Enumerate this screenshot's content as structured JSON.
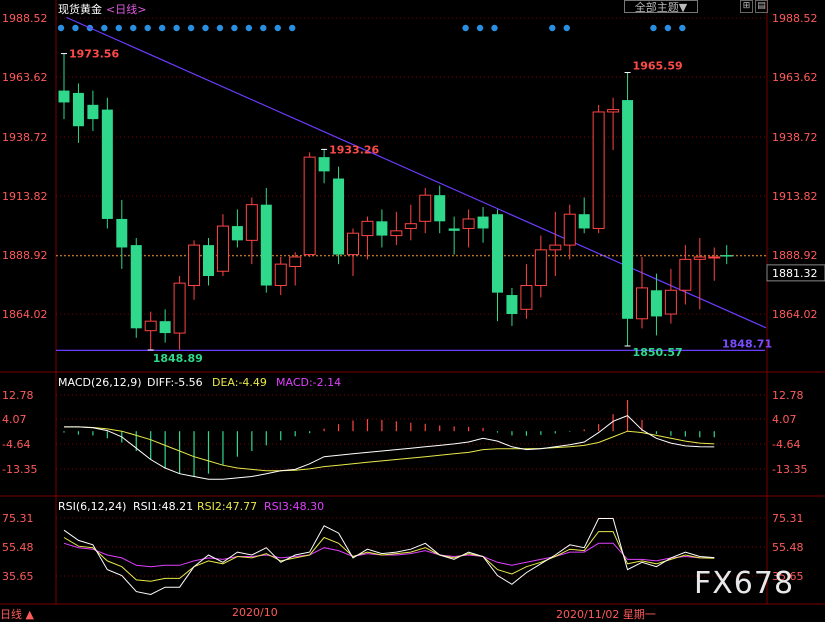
{
  "header": {
    "title": "现货黄金",
    "period": "<日线>",
    "theme_button": "全部主题▼",
    "tool_icon_1": "⊞",
    "tool_icon_2": "▤"
  },
  "colors": {
    "up": "#ff4444",
    "down": "#2fd88a",
    "grid": "#7a0000",
    "axis_label": "#ff5a5a",
    "trendline": "#6a3cff",
    "last_price_line": "#d79a3a",
    "macd_diff": "#ffffff",
    "macd_dea": "#e8e84a",
    "rsi1": "#ffffff",
    "rsi2": "#e8e84a",
    "rsi3": "#e040ff",
    "dots": "#2a8fe0"
  },
  "price_axis": {
    "ticks": [
      "1988.52",
      "1963.62",
      "1938.72",
      "1913.82",
      "1888.92",
      "1864.02"
    ],
    "last_price": "1881.32"
  },
  "annotations": {
    "high1": "1973.56",
    "low1": "1848.89",
    "mid_high": "1933.26",
    "high2": "1965.59",
    "low2": "1850.57",
    "support": "1848.71"
  },
  "macd": {
    "legend_name": "MACD(26,12,9)",
    "diff": "DIFF:-5.56",
    "dea": "DEA:-4.49",
    "macd": "MACD:-2.14",
    "ticks": [
      "12.78",
      "4.07",
      "-4.64",
      "-13.35"
    ]
  },
  "rsi": {
    "legend_name": "RSI(6,12,24)",
    "rsi1": "RSI1:48.21",
    "rsi2": "RSI2:47.77",
    "rsi3": "RSI3:48.30",
    "ticks": [
      "75.31",
      "55.48",
      "35.65"
    ]
  },
  "bottom": {
    "period_label": "日线 ▲",
    "date1": "2020/10",
    "date2": "2020/11/02 星期一"
  },
  "watermark": "FX678",
  "chart_data": {
    "type": "candlestick",
    "series_unit": "USD/oz",
    "ylim": [
      1840,
      1992
    ],
    "candles": [
      {
        "o": 1958,
        "h": 1973.56,
        "l": 1946,
        "c": 1953
      },
      {
        "o": 1957,
        "h": 1961,
        "l": 1936,
        "c": 1943
      },
      {
        "o": 1952,
        "h": 1958,
        "l": 1941,
        "c": 1946
      },
      {
        "o": 1950,
        "h": 1955,
        "l": 1900,
        "c": 1904
      },
      {
        "o": 1904,
        "h": 1912,
        "l": 1883,
        "c": 1892
      },
      {
        "o": 1893,
        "h": 1896,
        "l": 1854,
        "c": 1858
      },
      {
        "o": 1857,
        "h": 1865,
        "l": 1848.89,
        "c": 1861
      },
      {
        "o": 1861,
        "h": 1866,
        "l": 1852,
        "c": 1856
      },
      {
        "o": 1856,
        "h": 1880,
        "l": 1849,
        "c": 1877
      },
      {
        "o": 1876,
        "h": 1895,
        "l": 1870,
        "c": 1893
      },
      {
        "o": 1893,
        "h": 1896,
        "l": 1876,
        "c": 1880
      },
      {
        "o": 1882,
        "h": 1906,
        "l": 1880,
        "c": 1901
      },
      {
        "o": 1901,
        "h": 1908,
        "l": 1892,
        "c": 1895
      },
      {
        "o": 1895,
        "h": 1913,
        "l": 1885,
        "c": 1910
      },
      {
        "o": 1910,
        "h": 1917,
        "l": 1873,
        "c": 1876
      },
      {
        "o": 1876,
        "h": 1888,
        "l": 1872,
        "c": 1885
      },
      {
        "o": 1884,
        "h": 1890,
        "l": 1876,
        "c": 1888
      },
      {
        "o": 1889,
        "h": 1932,
        "l": 1888,
        "c": 1930
      },
      {
        "o": 1930,
        "h": 1933.26,
        "l": 1919,
        "c": 1924
      },
      {
        "o": 1921,
        "h": 1926,
        "l": 1885,
        "c": 1889
      },
      {
        "o": 1889,
        "h": 1900,
        "l": 1880,
        "c": 1898
      },
      {
        "o": 1897,
        "h": 1905,
        "l": 1887,
        "c": 1903
      },
      {
        "o": 1903,
        "h": 1908,
        "l": 1892,
        "c": 1897
      },
      {
        "o": 1897,
        "h": 1907,
        "l": 1893,
        "c": 1899
      },
      {
        "o": 1900,
        "h": 1910,
        "l": 1895,
        "c": 1902
      },
      {
        "o": 1903,
        "h": 1917,
        "l": 1898,
        "c": 1914
      },
      {
        "o": 1914,
        "h": 1918,
        "l": 1898,
        "c": 1903
      },
      {
        "o": 1900,
        "h": 1905,
        "l": 1889,
        "c": 1899
      },
      {
        "o": 1900,
        "h": 1908,
        "l": 1892,
        "c": 1904
      },
      {
        "o": 1905,
        "h": 1909,
        "l": 1894,
        "c": 1900
      },
      {
        "o": 1906,
        "h": 1908,
        "l": 1861,
        "c": 1873
      },
      {
        "o": 1872,
        "h": 1875,
        "l": 1859,
        "c": 1864
      },
      {
        "o": 1866,
        "h": 1885,
        "l": 1862,
        "c": 1876
      },
      {
        "o": 1876,
        "h": 1897,
        "l": 1871,
        "c": 1891
      },
      {
        "o": 1891,
        "h": 1907,
        "l": 1880,
        "c": 1893
      },
      {
        "o": 1893,
        "h": 1910,
        "l": 1887,
        "c": 1906
      },
      {
        "o": 1906,
        "h": 1913,
        "l": 1898,
        "c": 1900
      },
      {
        "o": 1900,
        "h": 1952,
        "l": 1898,
        "c": 1949
      },
      {
        "o": 1949,
        "h": 1955,
        "l": 1933,
        "c": 1950
      },
      {
        "o": 1954,
        "h": 1965.59,
        "l": 1850.57,
        "c": 1862
      },
      {
        "o": 1862,
        "h": 1888,
        "l": 1858,
        "c": 1875
      },
      {
        "o": 1874,
        "h": 1881,
        "l": 1855,
        "c": 1863
      },
      {
        "o": 1864,
        "h": 1883,
        "l": 1860,
        "c": 1874
      },
      {
        "o": 1874,
        "h": 1893,
        "l": 1868,
        "c": 1887
      },
      {
        "o": 1887,
        "h": 1896,
        "l": 1866,
        "c": 1888
      },
      {
        "o": 1888,
        "h": 1892,
        "l": 1878,
        "c": 1888
      }
    ],
    "trendline": {
      "from_index": 5,
      "from_value": 1985,
      "to_index": 48,
      "to_value": 1870
    },
    "support_value": 1848.71,
    "dot_groups": [
      [
        0,
        16
      ],
      [
        28,
        30
      ],
      [
        34,
        35
      ],
      [
        41,
        43
      ]
    ],
    "macd": {
      "ylim": [
        -22,
        16
      ],
      "bars": [
        -0.5,
        -1.2,
        -1.5,
        -2.5,
        -4,
        -7,
        -10,
        -13,
        -15,
        -16,
        -15,
        -12,
        -9,
        -7,
        -5,
        -3.2,
        -1.8,
        -0.7,
        0.9,
        2.5,
        3.8,
        4.3,
        4.0,
        3.5,
        3.0,
        2.6,
        2.0,
        1.7,
        1.5,
        1.2,
        -0.5,
        -1.5,
        -1.6,
        -1.3,
        -0.8,
        -0.2,
        0.6,
        2.5,
        6,
        11,
        4,
        -1,
        -1.6,
        -1.9,
        -2.2,
        -2.14
      ],
      "diff": [
        1.5,
        1.5,
        1.2,
        0.2,
        -2,
        -6,
        -10,
        -13,
        -15,
        -16,
        -17,
        -17,
        -16.5,
        -16,
        -15,
        -14,
        -13.5,
        -11.5,
        -9,
        -8.5,
        -8,
        -7.5,
        -7,
        -6.5,
        -6,
        -5.5,
        -5,
        -4.5,
        -3.8,
        -2.5,
        -3.5,
        -5.5,
        -6.5,
        -6.2,
        -5.5,
        -4.8,
        -3.8,
        -0.5,
        3.5,
        5.5,
        0.5,
        -2.5,
        -4.2,
        -5.2,
        -5.5,
        -5.56
      ],
      "dea": [
        1.5,
        1.5,
        1.3,
        0.8,
        0,
        -1.5,
        -3,
        -5,
        -7,
        -9,
        -10.5,
        -12,
        -13,
        -13.5,
        -14,
        -14,
        -13.8,
        -13.3,
        -12.5,
        -12,
        -11.5,
        -11,
        -10.5,
        -10,
        -9.5,
        -9,
        -8.5,
        -8,
        -7.5,
        -6.5,
        -6.2,
        -6.2,
        -6.2,
        -6.1,
        -5.8,
        -5.5,
        -5,
        -4,
        -2,
        0,
        -0.5,
        -1.5,
        -2.5,
        -3.5,
        -4.2,
        -4.49
      ]
    },
    "rsi": {
      "ylim": [
        20,
        80
      ],
      "rsi1": [
        67,
        60,
        57,
        40,
        36,
        25,
        23,
        28,
        28,
        42,
        50,
        45,
        52,
        50,
        55,
        45,
        50,
        52,
        70,
        65,
        48,
        54,
        51,
        52,
        54,
        58,
        50,
        47,
        52,
        49,
        36,
        30,
        38,
        44,
        50,
        57,
        55,
        75,
        75,
        40,
        45,
        42,
        48,
        52,
        49,
        48.21
      ],
      "rsi2": [
        62,
        56,
        55,
        46,
        42,
        33,
        32,
        34,
        34,
        42,
        46,
        44,
        49,
        48,
        51,
        46,
        48,
        50,
        62,
        58,
        49,
        52,
        50,
        51,
        52,
        55,
        50,
        48,
        51,
        49,
        40,
        37,
        42,
        45,
        49,
        54,
        53,
        66,
        66,
        44,
        46,
        44,
        47,
        50,
        48,
        47.77
      ],
      "rsi3": [
        58,
        55,
        54,
        50,
        48,
        43,
        42,
        43,
        43,
        46,
        48,
        47,
        49,
        49,
        50,
        48,
        49,
        50,
        55,
        53,
        49,
        51,
        50,
        50,
        51,
        53,
        50,
        49,
        50,
        49,
        45,
        43,
        45,
        47,
        49,
        52,
        52,
        58,
        58,
        47,
        47,
        46,
        48,
        49,
        48,
        48.3
      ]
    }
  }
}
